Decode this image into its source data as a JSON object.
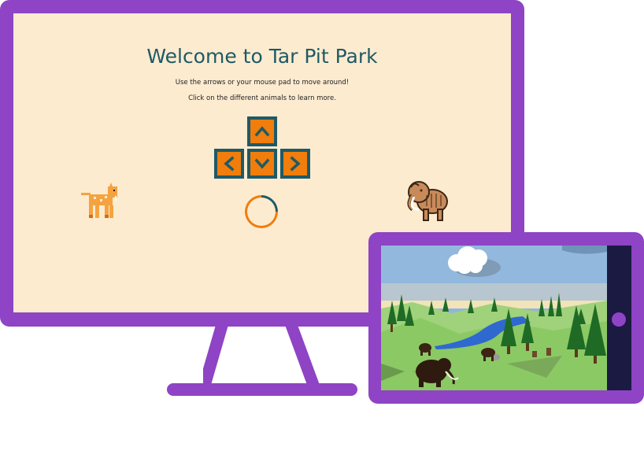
{
  "desktop": {
    "title": "Welcome to Tar Pit Park",
    "instructions": [
      "Use the arrows or your mouse pad to move around!",
      "Click on the different animals to learn more."
    ],
    "arrow_keys": [
      "arrow-up",
      "arrow-left",
      "arrow-down",
      "arrow-right"
    ],
    "animals": [
      "sabertooth-cat",
      "mammoth"
    ],
    "colors": {
      "frame": "#8e44c4",
      "screen_background": "#fdebd0",
      "title": "#1e5a66",
      "key_fill": "#f07d0c",
      "key_border": "#1e5a66"
    }
  },
  "tablet": {
    "scene": "3d-park-landscape",
    "scene_elements": [
      "cloud",
      "hills",
      "river",
      "pine-trees",
      "mammoths",
      "rocks"
    ],
    "colors": {
      "bezel": "#1b1a42",
      "home_button": "#8e44c4"
    }
  }
}
